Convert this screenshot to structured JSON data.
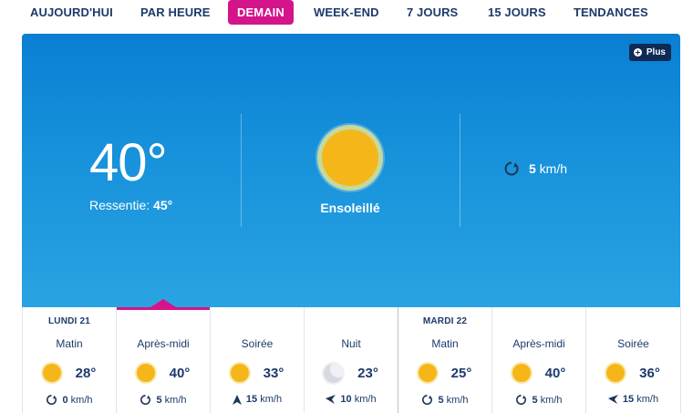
{
  "tabs": [
    {
      "label": "AUJOURD'HUI"
    },
    {
      "label": "PAR HEURE"
    },
    {
      "label": "DEMAIN"
    },
    {
      "label": "WEEK-END"
    },
    {
      "label": "7 JOURS"
    },
    {
      "label": "15 JOURS"
    },
    {
      "label": "TENDANCES"
    }
  ],
  "active_tab": "DEMAIN",
  "current": {
    "plus_label": "Plus",
    "temperature": "40°",
    "feels_like_label": "Ressentie: ",
    "feels_like_value": "45°",
    "condition": "Ensoleillé",
    "condition_icon": "sun-icon",
    "wind_icon": "wind-variable-icon",
    "wind_value": "5",
    "wind_unit": " km/h"
  },
  "forecast": [
    {
      "day": "LUNDI 21",
      "period": "Matin",
      "icon": "sun-icon",
      "temp": "28°",
      "wind_icon": "wind-variable-icon",
      "wind": "0",
      "unit": "km/h"
    },
    {
      "day": "",
      "period": "Après-midi",
      "icon": "sun-icon",
      "temp": "40°",
      "wind_icon": "wind-variable-icon",
      "wind": "5",
      "unit": "km/h"
    },
    {
      "day": "",
      "period": "Soirée",
      "icon": "sun-icon",
      "temp": "33°",
      "wind_icon": "wind-arrow-icon",
      "wind": "15",
      "unit": "km/h"
    },
    {
      "day": "",
      "period": "Nuit",
      "icon": "moon-icon",
      "temp": "23°",
      "wind_icon": "wind-arrow-icon",
      "wind": "10",
      "unit": "km/h"
    },
    {
      "day": "MARDI 22",
      "period": "Matin",
      "icon": "sun-icon",
      "temp": "25°",
      "wind_icon": "wind-variable-icon",
      "wind": "5",
      "unit": "km/h"
    },
    {
      "day": "",
      "period": "Après-midi",
      "icon": "sun-icon",
      "temp": "40°",
      "wind_icon": "wind-variable-icon",
      "wind": "5",
      "unit": "km/h"
    },
    {
      "day": "",
      "period": "Soirée",
      "icon": "sun-icon",
      "temp": "36°",
      "wind_icon": "wind-arrow-icon",
      "wind": "15",
      "unit": "km/h"
    }
  ],
  "colors": {
    "accent": "#d4148a",
    "card_top": "#0a7fd2",
    "card_bottom": "#2aa3e2",
    "sun": "#f4b619",
    "text_dark": "#1d3a6b"
  }
}
